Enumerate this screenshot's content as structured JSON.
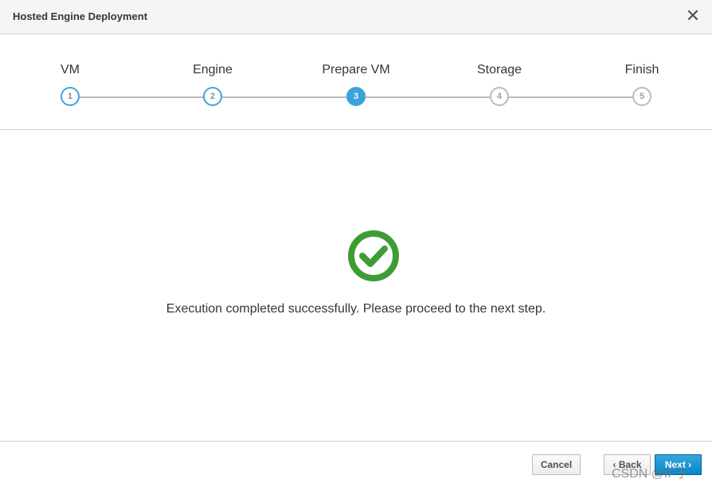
{
  "dialog": {
    "title": "Hosted Engine Deployment",
    "close_icon": "close-icon"
  },
  "wizard": {
    "steps": [
      {
        "label": "VM",
        "number": "1",
        "state": "done"
      },
      {
        "label": "Engine",
        "number": "2",
        "state": "done"
      },
      {
        "label": "Prepare VM",
        "number": "3",
        "state": "current"
      },
      {
        "label": "Storage",
        "number": "4",
        "state": "todo"
      },
      {
        "label": "Finish",
        "number": "5",
        "state": "todo"
      }
    ]
  },
  "content": {
    "status_icon": "check-circle-icon",
    "message": "Execution completed successfully. Please proceed to the next step."
  },
  "footer": {
    "cancel_label": "Cancel",
    "back_label": "‹ Back",
    "next_label": "Next ›"
  },
  "watermark": "CSDN @fF于",
  "colors": {
    "accent": "#39a5dc",
    "success": "#3f9c35",
    "inactive": "#bbbbbb"
  }
}
